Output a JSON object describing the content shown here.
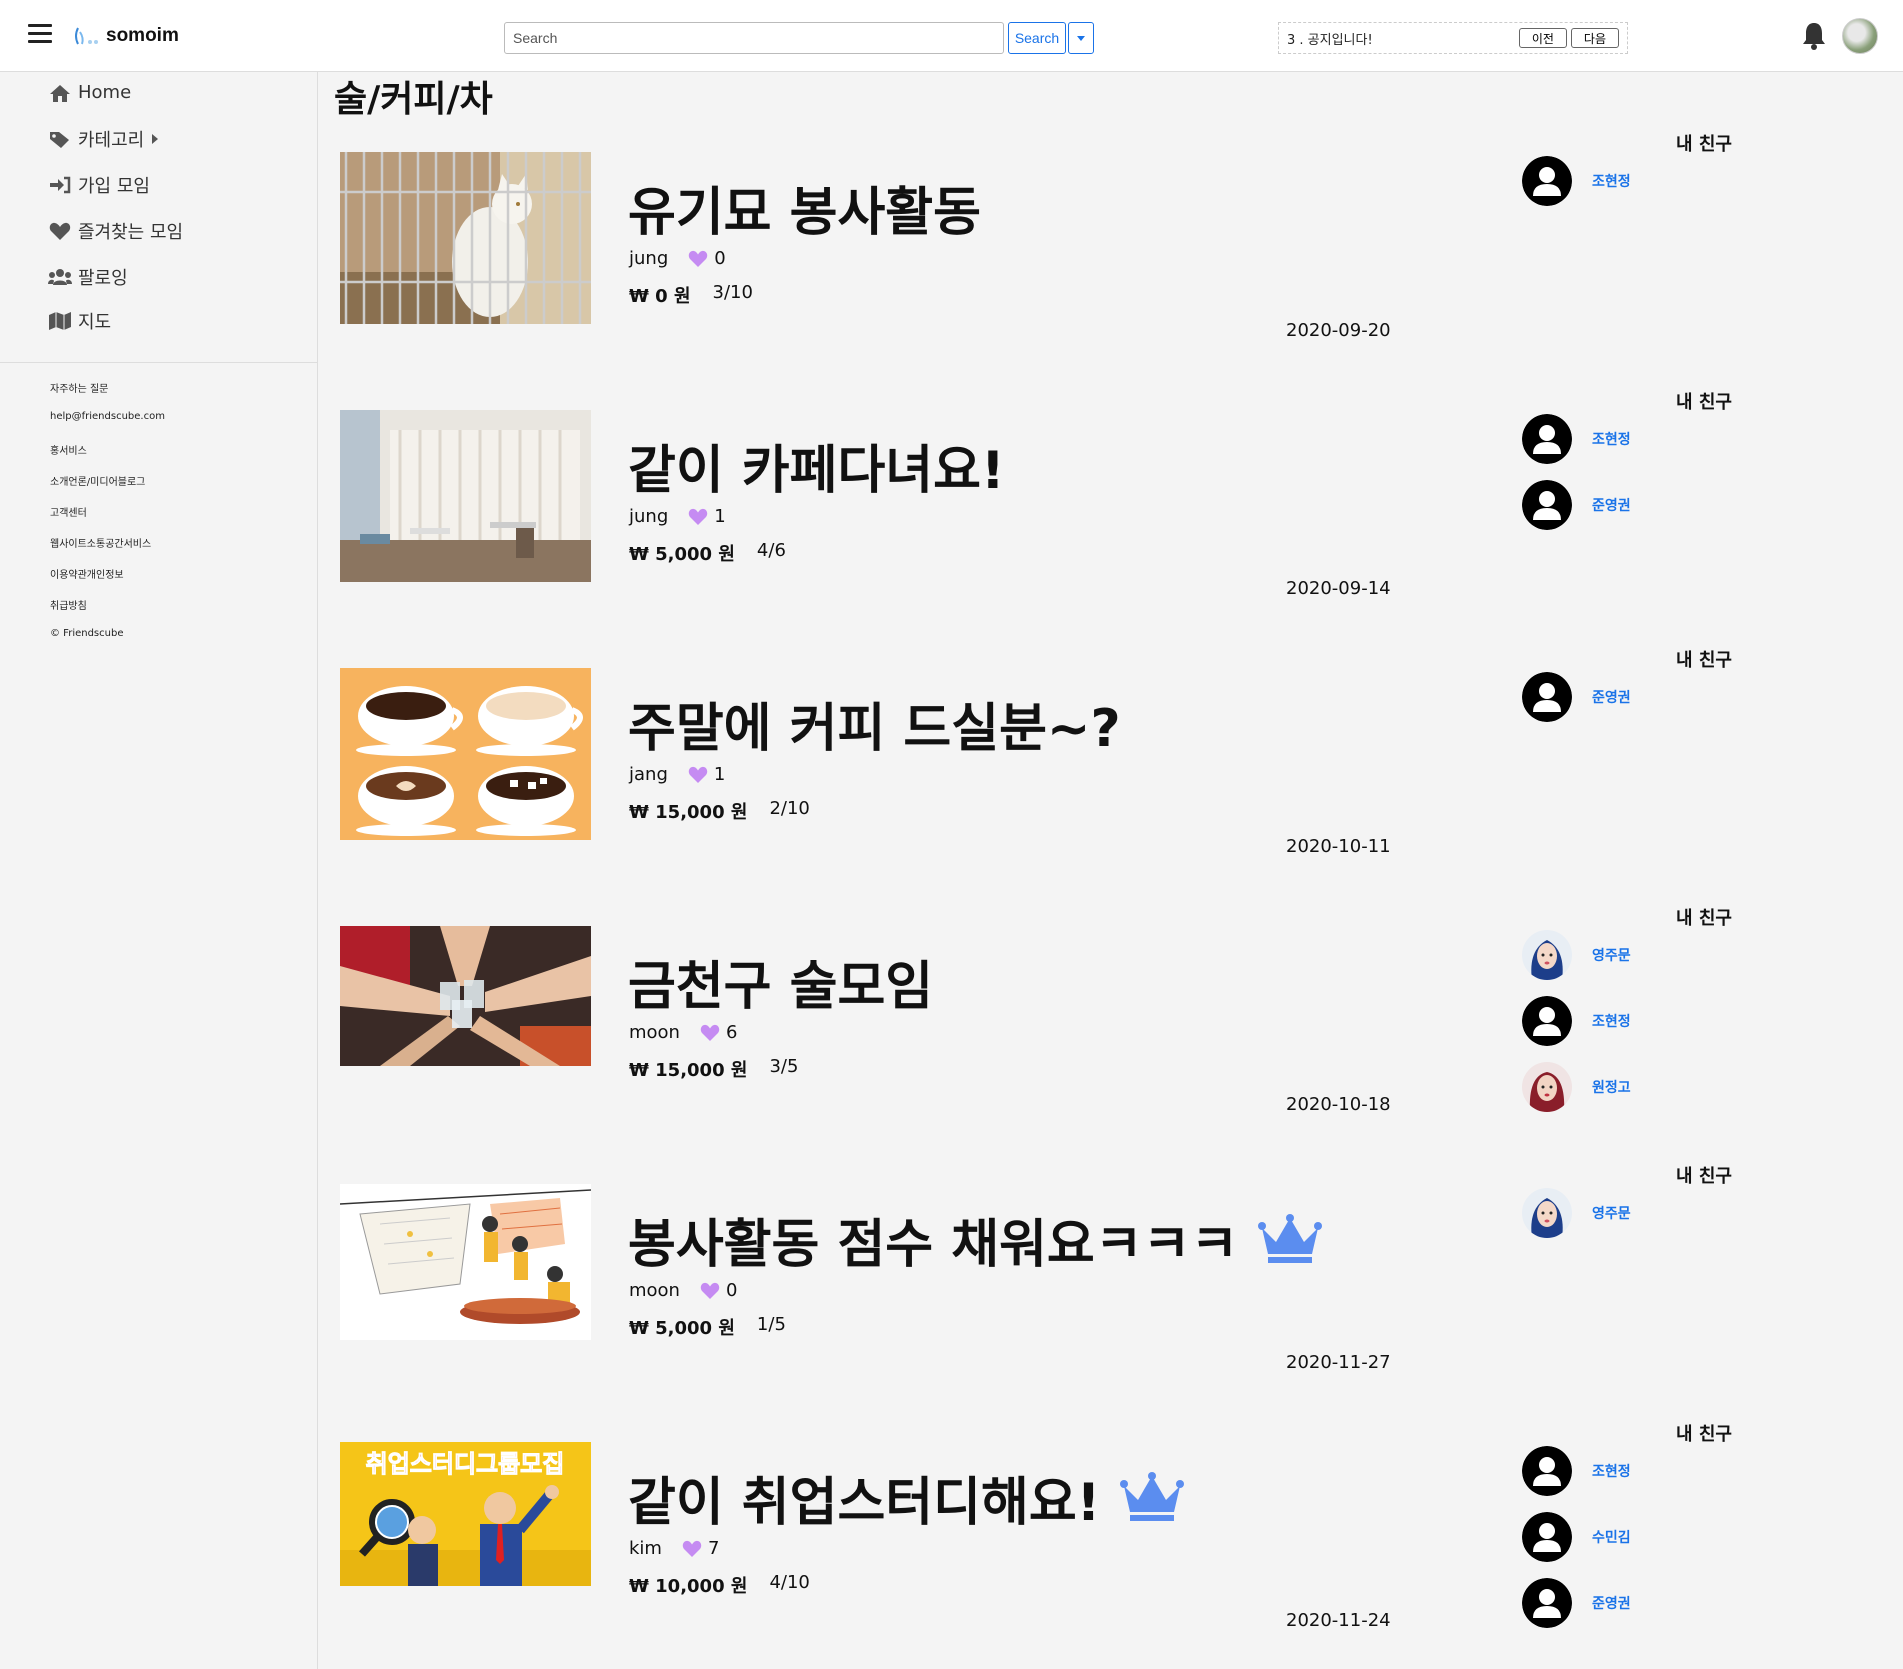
{
  "header": {
    "logo_text": "somoim",
    "search_placeholder": "Search",
    "search_button": "Search",
    "notice_text": "3 . 공지입니다!",
    "notice_prev": "이전",
    "notice_next": "다음"
  },
  "sidebar": {
    "nav": [
      {
        "label": "Home",
        "icon": "home-icon"
      },
      {
        "label": "카테고리",
        "icon": "tags-icon"
      },
      {
        "label": "가입 모임",
        "icon": "sign-in-icon"
      },
      {
        "label": "즐겨찾는 모임",
        "icon": "heart-icon"
      },
      {
        "label": "팔로잉",
        "icon": "users-icon"
      },
      {
        "label": "지도",
        "icon": "map-icon"
      }
    ],
    "footer_links": [
      "자주하는 질문",
      "help@friendscube.com",
      "홍서비스",
      "소개언론/미디어블로그",
      "고객센터",
      "웹사이트소통공간서비스",
      "이용약관개인정보",
      "취급방침",
      "© Friendscube"
    ]
  },
  "page_title": "술/커피/차",
  "friends_label": "내 친구",
  "currency": "₩",
  "won": "원",
  "groups": [
    {
      "title": "유기묘 봉사활동",
      "owner": "jung",
      "likes": "0",
      "price": "0",
      "members": "3/10",
      "date": "2020-09-20",
      "premium": false,
      "friends": [
        {
          "name": "조현정",
          "avatar": "default"
        }
      ]
    },
    {
      "title": "같이 카페다녀요!",
      "owner": "jung",
      "likes": "1",
      "price": "5,000",
      "members": "4/6",
      "date": "2020-09-14",
      "premium": false,
      "friends": [
        {
          "name": "조현정",
          "avatar": "default"
        },
        {
          "name": "준영권",
          "avatar": "default"
        }
      ]
    },
    {
      "title": "주말에 커피 드실분~?",
      "owner": "jang",
      "likes": "1",
      "price": "15,000",
      "members": "2/10",
      "date": "2020-10-11",
      "premium": false,
      "friends": [
        {
          "name": "준영권",
          "avatar": "default"
        }
      ]
    },
    {
      "title": "금천구 술모임",
      "owner": "moon",
      "likes": "6",
      "price": "15,000",
      "members": "3/5",
      "date": "2020-10-18",
      "premium": false,
      "friends": [
        {
          "name": "영주문",
          "avatar": "photo-blue"
        },
        {
          "name": "조현정",
          "avatar": "default"
        },
        {
          "name": "원정고",
          "avatar": "photo-red"
        }
      ]
    },
    {
      "title": "봉사활동 점수 채워요ㅋㅋㅋ",
      "owner": "moon",
      "likes": "0",
      "price": "5,000",
      "members": "1/5",
      "date": "2020-11-27",
      "premium": true,
      "friends": [
        {
          "name": "영주문",
          "avatar": "photo-blue"
        }
      ]
    },
    {
      "title": "같이 취업스터디해요!",
      "owner": "kim",
      "likes": "7",
      "price": "10,000",
      "members": "4/10",
      "date": "2020-11-24",
      "premium": true,
      "friends": [
        {
          "name": "조현정",
          "avatar": "default"
        },
        {
          "name": "수민김",
          "avatar": "default"
        },
        {
          "name": "준영권",
          "avatar": "default"
        }
      ]
    }
  ],
  "thumb_banner_text": "취업스터디그룹모집",
  "colors": {
    "accent": "#1a73e8",
    "heart": "#c58bf2",
    "crown": "#5b8def"
  }
}
